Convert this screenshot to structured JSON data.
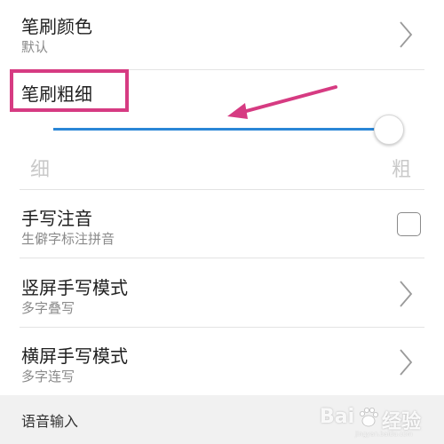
{
  "brush_color": {
    "title": "笔刷颜色",
    "value": "默认"
  },
  "brush_thickness": {
    "title": "笔刷粗细",
    "min_label": "细",
    "max_label": "粗",
    "value_fraction": 1.0
  },
  "handwriting_phonetic": {
    "title": "手写注音",
    "subtitle": "生僻字标注拼音",
    "checked": false
  },
  "portrait_mode": {
    "title": "竖屏手写模式",
    "value": "多字叠写"
  },
  "landscape_mode": {
    "title": "横屏手写模式",
    "value": "多字连写"
  },
  "section": {
    "title": "语音输入"
  },
  "watermark": {
    "text_left": "Bai",
    "text_right": "经验",
    "subtext": "jingyan.baidu.com"
  },
  "colors": {
    "accent": "#2a86d6",
    "highlight": "#d63b82"
  }
}
